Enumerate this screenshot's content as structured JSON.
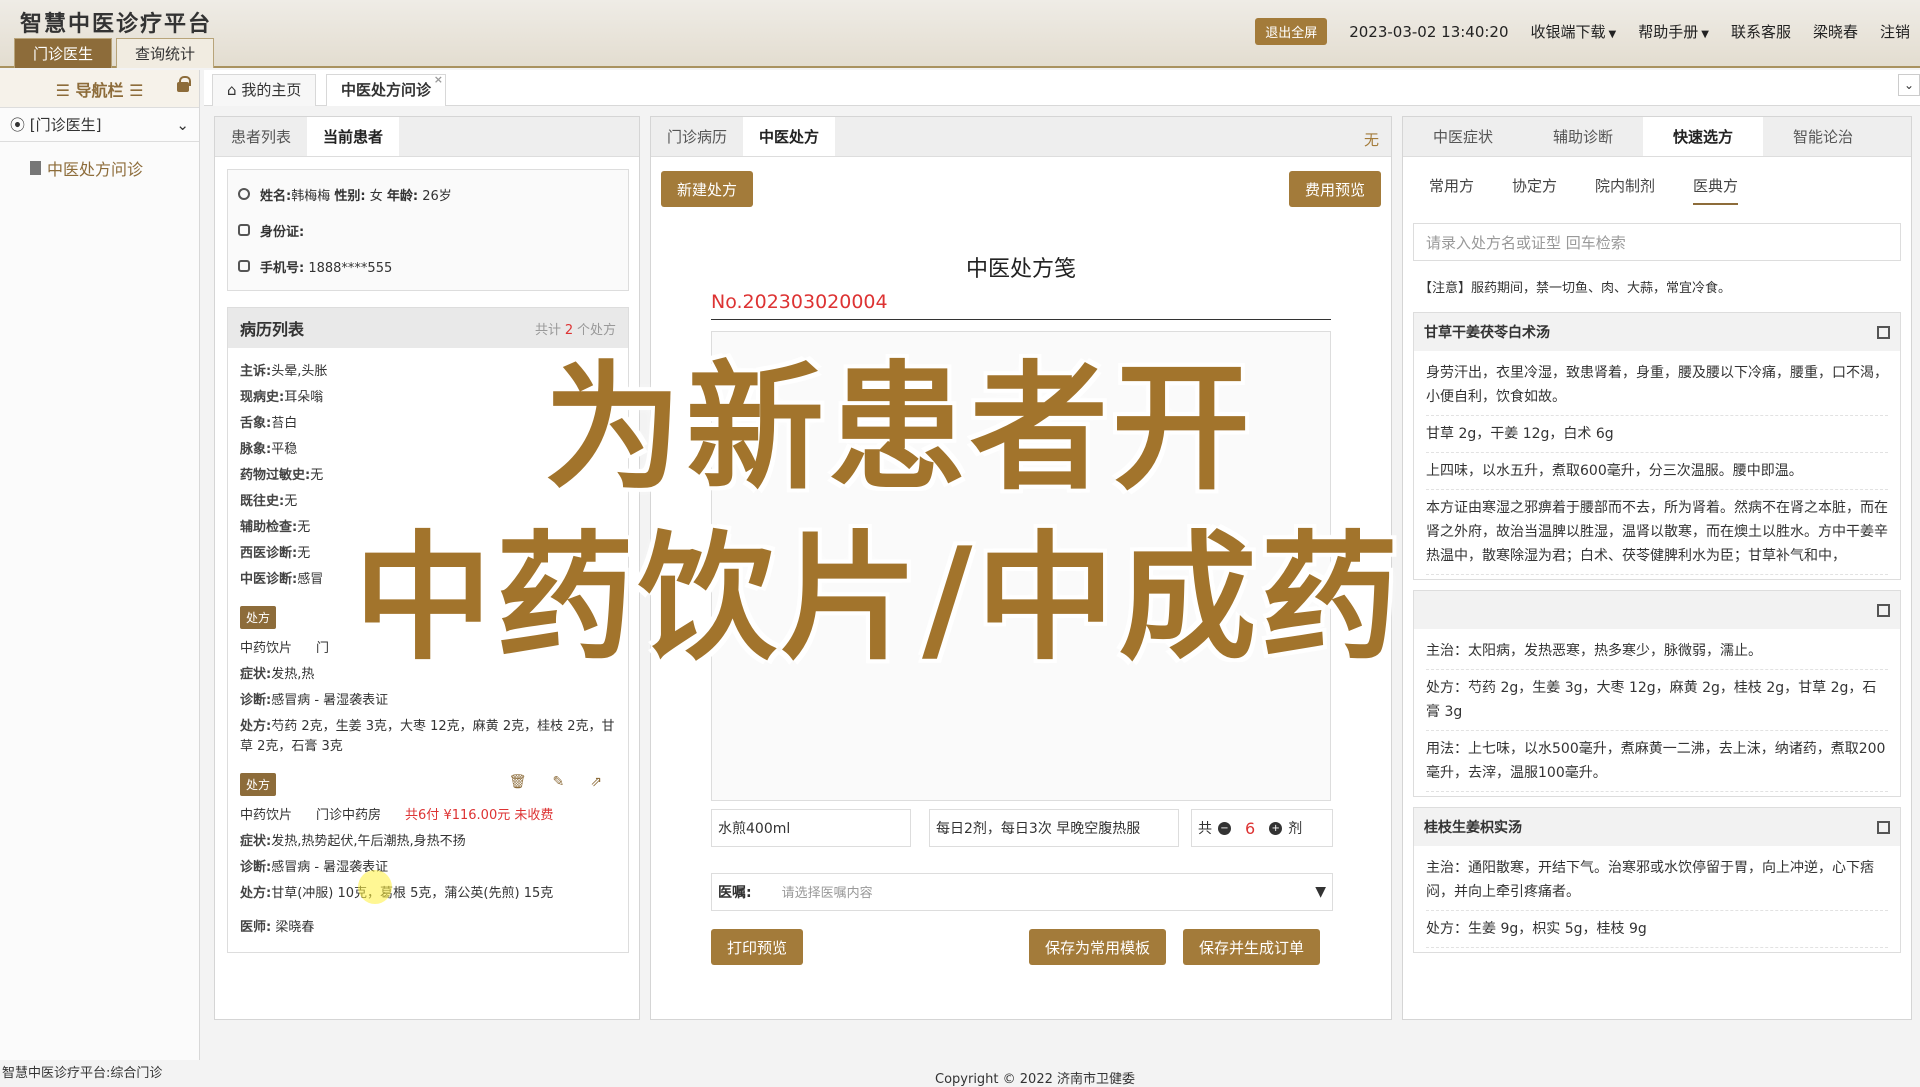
{
  "app": {
    "title": "智慧中医诊疗平台"
  },
  "top_tabs": [
    {
      "label": "门诊医生",
      "active": true
    },
    {
      "label": "查询统计",
      "active": false
    }
  ],
  "header": {
    "exit_fullscreen": "退出全屏",
    "datetime": "2023-03-02 13:40:20",
    "cashier_download": "收银端下载",
    "help_manual": "帮助手册",
    "contact_service": "联系客服",
    "user_name": "梁晓春",
    "logout": "注销"
  },
  "sidebar": {
    "title": "☰ 导航栏 ☰",
    "role_select": "[门诊医生]",
    "items": [
      {
        "label": "中医处方问诊"
      }
    ]
  },
  "page_tabs": [
    {
      "label": "我的主页"
    },
    {
      "label": "中医处方问诊",
      "active": true
    }
  ],
  "left_panel": {
    "tabs": [
      "患者列表",
      "当前患者"
    ],
    "patient": {
      "name_label": "姓名:",
      "name": "韩梅梅",
      "gender_label": "性别:",
      "gender": "女",
      "age_label": "年龄:",
      "age": "26岁",
      "id_label": "身份证:",
      "phone_label": "手机号:",
      "phone": "1888****555"
    },
    "history": {
      "title": "病历列表",
      "count_prefix": "共计",
      "count": "2",
      "count_suffix": "个处方",
      "lines": [
        {
          "label": "主诉:",
          "value": "头晕,头胀"
        },
        {
          "label": "现病史:",
          "value": "耳朵嗡"
        },
        {
          "label": "舌象:",
          "value": "苔白"
        },
        {
          "label": "脉象:",
          "value": "平稳"
        },
        {
          "label": "药物过敏史:",
          "value": "无"
        },
        {
          "label": "既往史:",
          "value": "无"
        },
        {
          "label": "辅助检查:",
          "value": "无"
        },
        {
          "label": "西医诊断:",
          "value": "无"
        },
        {
          "label": "中医诊断:",
          "value": "感冒"
        }
      ],
      "rx1": {
        "badge": "处方",
        "type": "中药饮片",
        "pharmacy": "门",
        "symptom_label": "症状:",
        "symptom": "发热,热",
        "diagnosis_label": "诊断:",
        "diagnosis": "感冒病 - 暑湿袭表证",
        "rx_label": "处方:",
        "rx": "芍药 2克，生姜 3克，大枣 12克，麻黄 2克，桂枝 2克，甘草 2克，石膏 3克"
      },
      "rx2": {
        "badge": "处方",
        "type": "中药饮片",
        "pharmacy": "门诊中药房",
        "doses": "共6付",
        "amount": "¥116.00元",
        "status": "未收费",
        "symptom_label": "症状:",
        "symptom": "发热,热势起伏,午后潮热,身热不扬",
        "diagnosis_label": "诊断:",
        "diagnosis": "感冒病 - 暑湿袭表证",
        "rx_label": "处方:",
        "rx": "甘草(冲服) 10克，葛根 5克，蒲公英(先煎) 15克"
      },
      "doctor_label": "医师:",
      "doctor": "梁晓春"
    }
  },
  "mid_panel": {
    "tabs": [
      "门诊病历",
      "中医处方"
    ],
    "tab_right_text": "无",
    "new_rx": "新建处方",
    "fee_preview": "费用预览",
    "rx_title": "中医处方笺",
    "rx_no": "No.202303020004",
    "decoction": "水煎400ml",
    "usage": "每日2剂，每日3次 早晚空腹热服",
    "qty_prefix": "共",
    "qty": "6",
    "qty_suffix": "剂",
    "advice_label": "医嘱:",
    "advice_placeholder": "请选择医嘱内容",
    "print_preview": "打印预览",
    "save_template": "保存为常用模板",
    "save_order": "保存并生成订单"
  },
  "right_panel": {
    "tabs": [
      "中医症状",
      "辅助诊断",
      "快速选方",
      "智能论治"
    ],
    "sub_tabs": [
      "常用方",
      "协定方",
      "院内制剂",
      "医典方"
    ],
    "search_placeholder": "请录入处方名或证型 回车检索",
    "notice": "【注意】服药期间，禁一切鱼、肉、大蒜，常宜冷食。",
    "formulas": [
      {
        "name": "甘草干姜茯苓白术汤",
        "lines": [
          "身劳汗出，衣里冷湿，致患肾着，身重，腰及腰以下冷痛，腰重，口不渴，小便自利，饮食如故。",
          "甘草 2g，干姜 12g，白术 6g",
          "上四味，以水五升，煮取600毫升，分三次温服。腰中即温。",
          "本方证由寒湿之邪痹着于腰部而不去，所为肾着。然病不在肾之本脏，而在肾之外府，故治当温脾以胜湿，温肾以散寒，而在燠土以胜水。方中干姜辛热温中，散寒除湿为君；白术、茯苓健脾利水为臣；甘草补气和中，"
        ]
      },
      {
        "name": "",
        "lines": [
          "主治：太阳病，发热恶寒，热多寒少，脉微弱，濡止。",
          "处方：芍药 2g，生姜 3g，大枣 12g，麻黄 2g，桂枝 2g，甘草 2g，石膏 3g",
          "用法：上七味，以水500毫升，煮麻黄一二沸，去上沫，纳诸药，煮取200毫升，去滓，温服100毫升。"
        ]
      },
      {
        "name": "桂枝生姜枳实汤",
        "lines": [
          "主治：通阳散寒，开结下气。治寒邪或水饮停留于胃，向上冲逆，心下痞闷，并向上牵引疼痛者。",
          "处方：生姜 9g，枳实 5g，桂枝 9g"
        ]
      }
    ]
  },
  "overlay": {
    "line1": "为新患者开",
    "line2": "中药饮片/中成药"
  },
  "footer": {
    "left": "智慧中医诊疗平台:综合门诊",
    "center": "Copyright © 2022  济南市卫健委"
  }
}
